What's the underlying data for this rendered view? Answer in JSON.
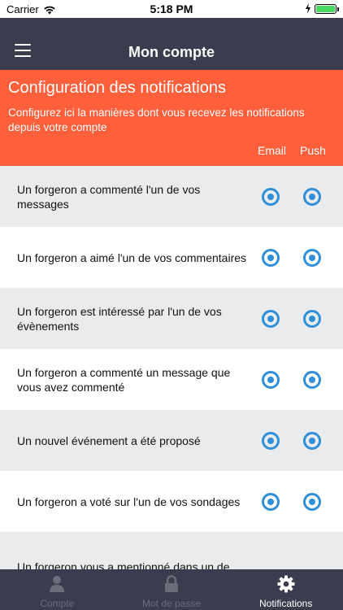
{
  "status_bar": {
    "carrier": "Carrier",
    "time": "5:18 PM"
  },
  "nav": {
    "title": "Mon compte",
    "menu_icon": "hamburger-menu-icon"
  },
  "header": {
    "title": "Configuration des notifications",
    "description": "Configurez ici la manières dont vous recevez les notifications depuis votre compte",
    "columns": {
      "email": "Email",
      "push": "Push"
    },
    "background_color": "#ff5f3b"
  },
  "rows": [
    {
      "label": "Un forgeron a commenté l'un de vos messages",
      "email": true,
      "push": true
    },
    {
      "label": "Un forgeron a aimé l'un de vos commentaires",
      "email": true,
      "push": true
    },
    {
      "label": "Un forgeron est intéressé par l'un de vos évènements",
      "email": true,
      "push": true
    },
    {
      "label": "Un forgeron a commenté un message que vous avez commenté",
      "email": true,
      "push": true
    },
    {
      "label": "Un nouvel événement a été proposé",
      "email": true,
      "push": true
    },
    {
      "label": "Un forgeron a voté sur l'un de vos sondages",
      "email": true,
      "push": true
    },
    {
      "label": "Un forgeron vous a mentionné dans un de",
      "email": true,
      "push": true
    }
  ],
  "tabs": [
    {
      "label": "Compte",
      "icon": "user-icon",
      "active": false
    },
    {
      "label": "Mot de passe",
      "icon": "lock-icon",
      "active": false
    },
    {
      "label": "Notifications",
      "icon": "gear-icon",
      "active": true
    }
  ],
  "colors": {
    "accent": "#2f8fd8",
    "nav": "#3a3d4d",
    "row_shaded": "#eaebed"
  }
}
